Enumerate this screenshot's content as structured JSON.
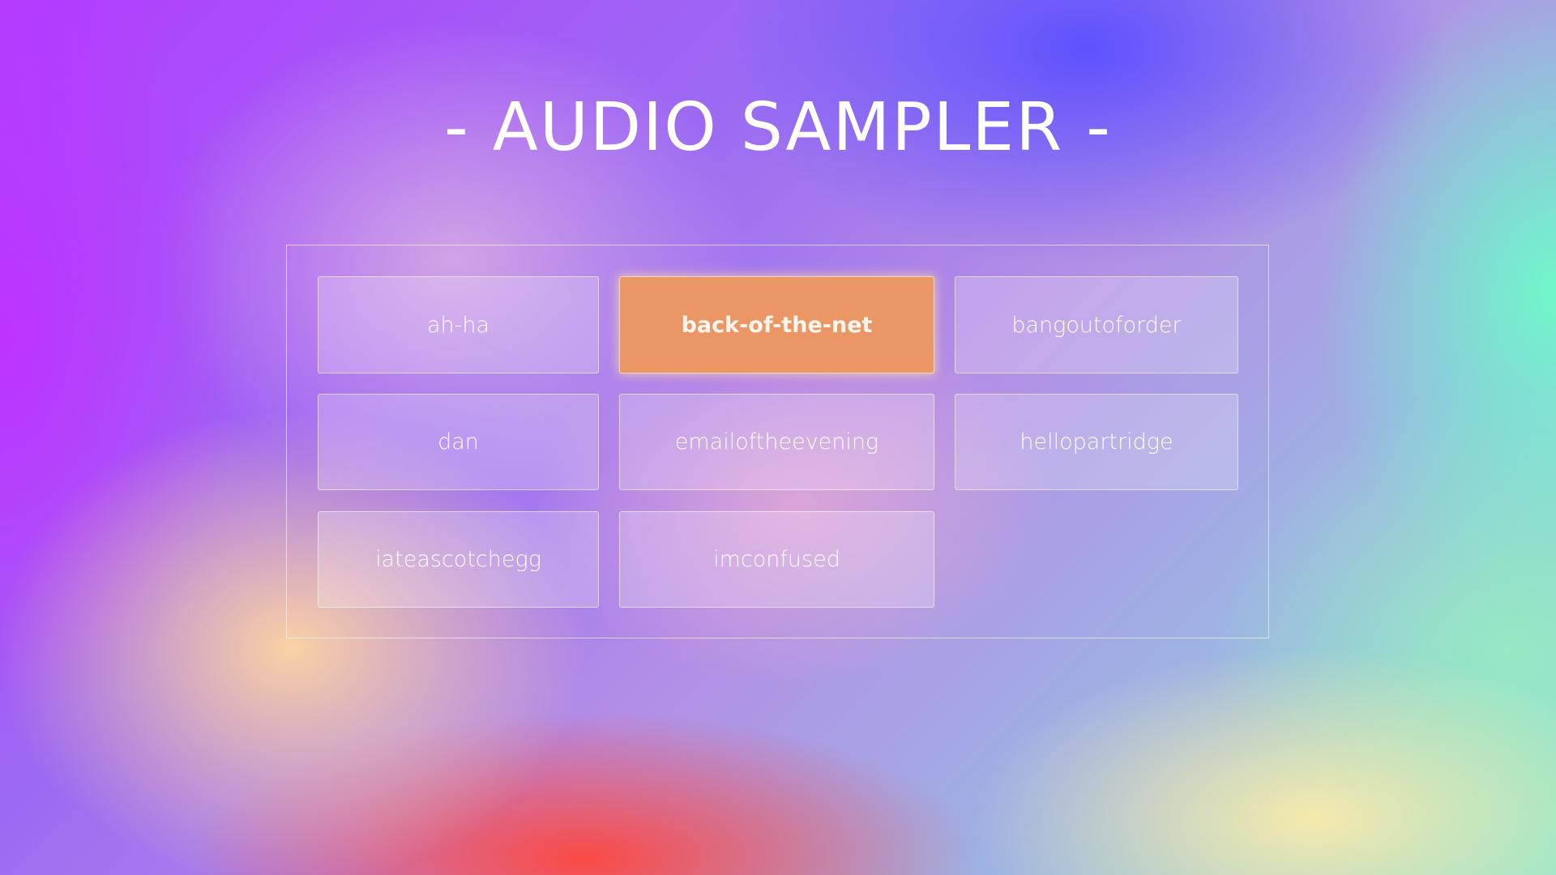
{
  "app": {
    "title": "- AUDIO SAMPLER -"
  },
  "pads": [
    {
      "label": "ah-ha",
      "active": false
    },
    {
      "label": "back-of-the-net",
      "active": true
    },
    {
      "label": "bangoutoforder",
      "active": false
    },
    {
      "label": "dan",
      "active": false
    },
    {
      "label": "emailoftheevening",
      "active": false
    },
    {
      "label": "hellopartridge",
      "active": false
    },
    {
      "label": "iateascotchegg",
      "active": false
    },
    {
      "label": "imconfused",
      "active": false
    }
  ],
  "colors": {
    "active_pad": "#ea9765",
    "text": "#ffffff"
  }
}
